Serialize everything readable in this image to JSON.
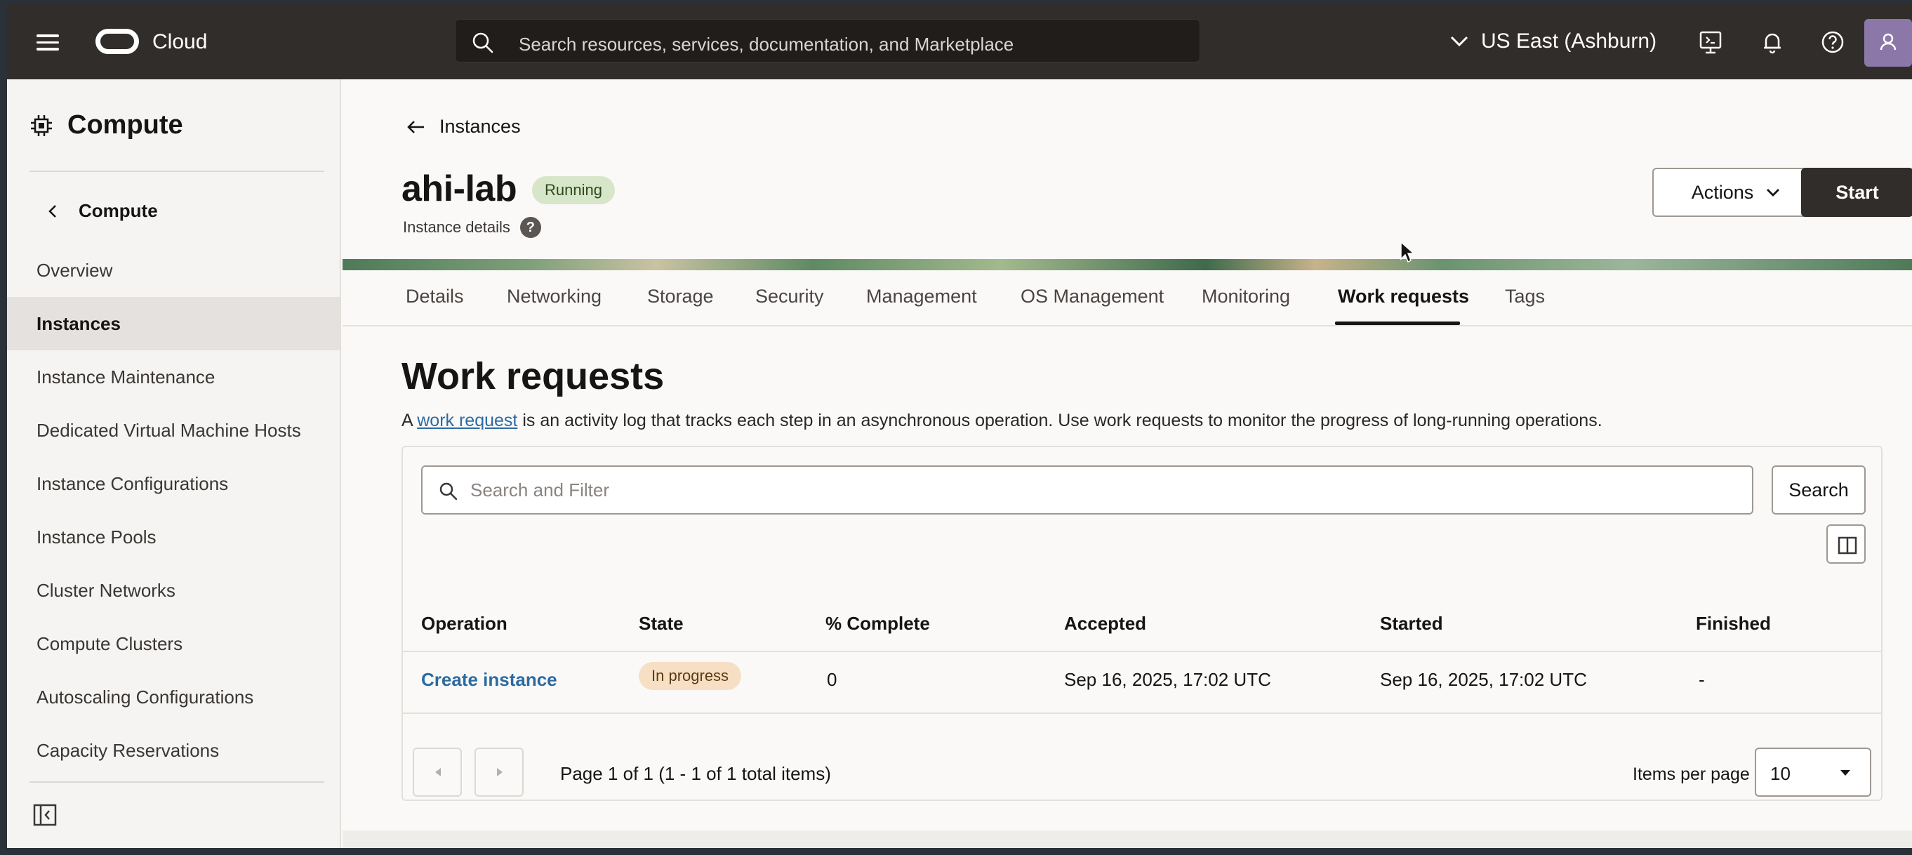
{
  "topbar": {
    "brand": "Cloud",
    "search_placeholder": "Search resources, services, documentation, and Marketplace",
    "region": "US East (Ashburn)"
  },
  "sidebar": {
    "title": "Compute",
    "back_label": "Compute",
    "items": [
      {
        "label": "Overview"
      },
      {
        "label": "Instances",
        "active": true
      },
      {
        "label": "Instance Maintenance"
      },
      {
        "label": "Dedicated Virtual Machine Hosts"
      },
      {
        "label": "Instance Configurations"
      },
      {
        "label": "Instance Pools"
      },
      {
        "label": "Cluster Networks"
      },
      {
        "label": "Compute Clusters"
      },
      {
        "label": "Autoscaling Configurations"
      },
      {
        "label": "Capacity Reservations"
      }
    ]
  },
  "header": {
    "back_label": "Instances",
    "instance_name": "ahi-lab",
    "status": "Running",
    "subtitle": "Instance details",
    "help": "?",
    "actions_label": "Actions",
    "start_label": "Start"
  },
  "tabs": [
    {
      "label": "Details"
    },
    {
      "label": "Networking"
    },
    {
      "label": "Storage"
    },
    {
      "label": "Security"
    },
    {
      "label": "Management"
    },
    {
      "label": "OS Management"
    },
    {
      "label": "Monitoring"
    },
    {
      "label": "Work requests",
      "active": true
    },
    {
      "label": "Tags"
    }
  ],
  "work_requests": {
    "title": "Work requests",
    "desc_prefix": "A ",
    "desc_link": "work request",
    "desc_suffix": " is an activity log that tracks each step in an asynchronous operation. Use work requests to monitor the progress of long-running operations.",
    "filter_placeholder": "Search and Filter",
    "search_button": "Search",
    "columns": [
      "Operation",
      "State",
      "% Complete",
      "Accepted",
      "Started",
      "Finished"
    ],
    "rows": [
      {
        "operation": "Create instance",
        "state": "In progress",
        "percent_complete": "0",
        "accepted": "Sep 16, 2025, 17:02 UTC",
        "started": "Sep 16, 2025, 17:02 UTC",
        "finished": "-"
      }
    ],
    "pagination_text": "Page 1 of 1 (1 - 1 of 1 total items)",
    "items_per_page_label": "Items per page",
    "items_per_page_value": "10"
  },
  "colors": {
    "topbar": "#312d2a",
    "running_badge": "#d7e6c8",
    "in_progress_badge": "#f6dfc4",
    "link": "#2b6ba3"
  }
}
